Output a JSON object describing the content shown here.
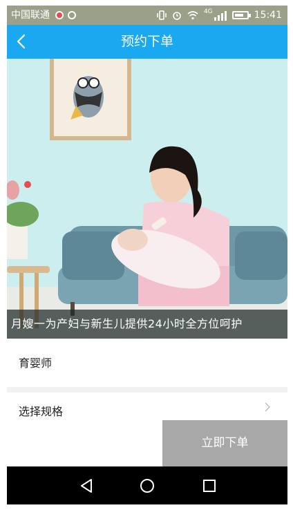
{
  "status_bar": {
    "carrier": "中国联通",
    "network": "4G",
    "time": "15:41"
  },
  "header": {
    "title": "预约下单",
    "back_icon": "chevron-left-icon"
  },
  "hero": {
    "caption": "月嫂一为产妇与新生儿提供24小时全方位呵护"
  },
  "product": {
    "name": "育婴师"
  },
  "spec": {
    "label": "选择规格",
    "icon": "chevron-right-icon"
  },
  "actions": {
    "order_label": "立即下单"
  },
  "nav_bar": {
    "icons": [
      "back-triangle-icon",
      "home-circle-icon",
      "recents-square-icon"
    ]
  },
  "colors": {
    "header": "#1aa8f0",
    "order_button": "#a8a8a8",
    "status_bar": "#9aa08a"
  }
}
